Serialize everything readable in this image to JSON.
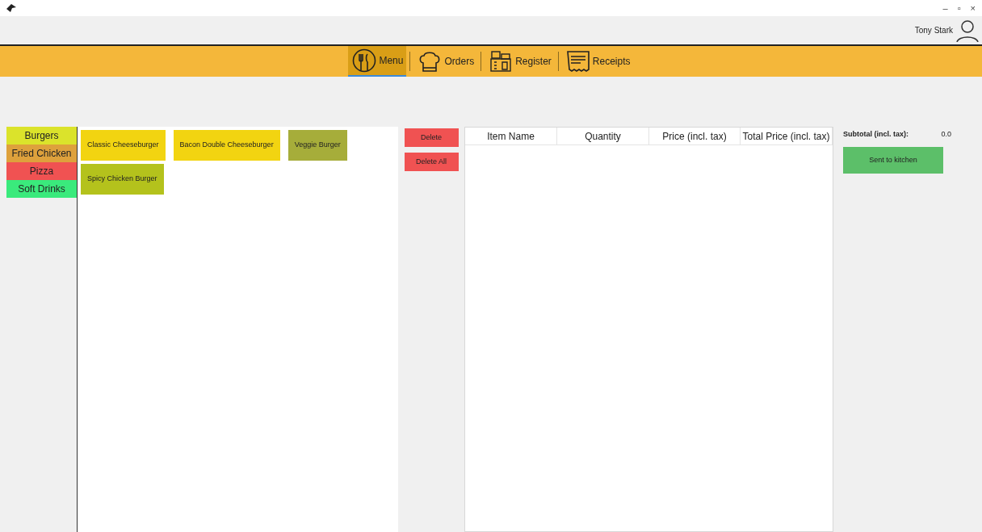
{
  "window": {
    "controls": [
      "–",
      "▫",
      "×"
    ]
  },
  "user": {
    "name": "Tony Stark"
  },
  "nav": [
    {
      "label": "Menu",
      "kind": "menu",
      "selected": true
    },
    {
      "label": "Orders",
      "kind": "orders",
      "selected": false
    },
    {
      "label": "Register",
      "kind": "register",
      "selected": false
    },
    {
      "label": "Receipts",
      "kind": "receipts",
      "selected": false
    }
  ],
  "categories": [
    {
      "label": "Burgers",
      "color": "#dbe32b"
    },
    {
      "label": "Fried Chicken",
      "color": "#dea13c"
    },
    {
      "label": "Pizza",
      "color": "#f05252"
    },
    {
      "label": "Soft Drinks",
      "color": "#3aea7c"
    }
  ],
  "products": [
    {
      "label": "Classic Cheeseburger",
      "color": "#f2d411"
    },
    {
      "label": "Bacon Double Cheeseburger",
      "color": "#f2d411"
    },
    {
      "label": "Veggie Burger",
      "color": "#a6ad3a"
    },
    {
      "label": "Spicy Chicken Burger",
      "color": "#b4c21c"
    }
  ],
  "actions": [
    "Delete",
    "Delete All"
  ],
  "table": {
    "columns": [
      "Item Name",
      "Quantity",
      "Price (incl. tax)",
      "Total Price (incl. tax)"
    ]
  },
  "summary": {
    "label": "Subtotal (incl. tax):",
    "value": "0.0",
    "button": "Sent to kitchen"
  }
}
